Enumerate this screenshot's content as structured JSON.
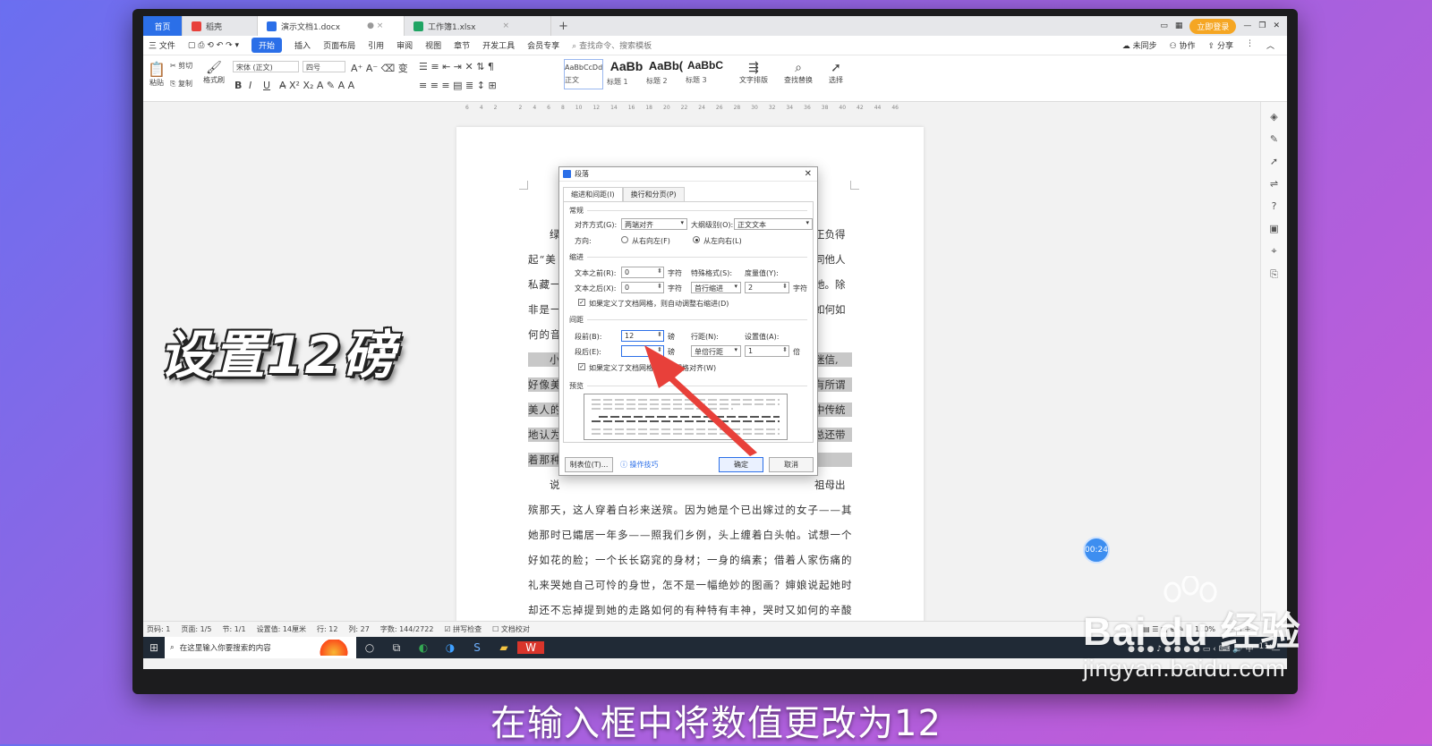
{
  "tabs": [
    {
      "label": "首页"
    },
    {
      "label": "稻壳"
    },
    {
      "label": "演示文档1.docx"
    },
    {
      "label": "工作簿1.xlsx"
    }
  ],
  "topright": {
    "login": "立即登录"
  },
  "menu": {
    "file": "三 文件",
    "items": [
      "开始",
      "插入",
      "页面布局",
      "引用",
      "审阅",
      "视图",
      "章节",
      "开发工具",
      "会员专享"
    ],
    "search": "查找命令、搜索模板",
    "sync": "未同步",
    "collab": "协作",
    "share": "分享"
  },
  "ribbon": {
    "paste": "粘贴",
    "cut": "剪切",
    "copy": "复制",
    "format_painter": "格式刷",
    "font_name": "宋体 (正文)",
    "font_size": "四号",
    "styles": [
      {
        "sample": "AaBbCcDd",
        "label": "正文"
      },
      {
        "sample": "AaBb",
        "label": "标题 1"
      },
      {
        "sample": "AaBb(",
        "label": "标题 2"
      },
      {
        "sample": "AaBbC",
        "label": "标题 3"
      }
    ],
    "text_layout": "文字排版",
    "find_replace": "查找替换",
    "select": "选择"
  },
  "ruler": [
    "6",
    "4",
    "2",
    "",
    "2",
    "4",
    "6",
    "8",
    "10",
    "12",
    "14",
    "16",
    "18",
    "20",
    "22",
    "24",
    "26",
    "28",
    "30",
    "32",
    "34",
    "36",
    "38",
    "40",
    "42",
    "44",
    "46"
  ],
  "document": {
    "lines": [
      {
        "text": "绿",
        "hl": false
      },
      {
        "text": "起“美",
        "hl": false
      },
      {
        "text": "私藏一",
        "hl": false
      },
      {
        "text": "非是一",
        "hl": false
      },
      {
        "text": "何的音",
        "hl": false
      },
      {
        "text": "小",
        "hl": true
      },
      {
        "text": "好像美",
        "hl": true
      },
      {
        "text": "美人的",
        "hl": true
      },
      {
        "text": "地认为",
        "hl": true
      },
      {
        "text": "着那种",
        "hl": true
      },
      {
        "text": "说",
        "hl": false
      },
      {
        "text": "殡那天，这人穿着白衫来送殡。因为她是个已出嫁过的女子——其实",
        "hl": false
      },
      {
        "text": "她那时已孀居一年多——照我们乡例，头上缠着白头帕。试想一个静",
        "hl": false
      },
      {
        "text": "好如花的脸；一个长长窈窕的身材；一身的缟素；借着人家伤痛的丧",
        "hl": false
      },
      {
        "text": "礼来哭她自己可怜的身世，怎不是一幅绝妙的图画？婶娘说起她时，",
        "hl": false
      },
      {
        "text": "却还不忘掉提到她的走路如何的有种特有丰神，哭时又如何的辛酸凄",
        "hl": false
      }
    ],
    "right_fragments": [
      "正负得",
      "同他人",
      "她。除",
      "如何如",
      "迷信,",
      "有所谓",
      "中传统",
      "总还带",
      "祖母出"
    ]
  },
  "dialog": {
    "title": "段落",
    "tab_indent": "缩进和间距(I)",
    "tab_breaks": "换行和分页(P)",
    "sec_general": "常规",
    "align_label": "对齐方式(G):",
    "align_value": "两端对齐",
    "outline_label": "大纲级别(O):",
    "outline_value": "正文文本",
    "direction_label": "方向:",
    "rtl": "从右向左(F)",
    "ltr": "从左向右(L)",
    "sec_indent": "缩进",
    "before_text_label": "文本之前(R):",
    "before_text_value": "0",
    "after_text_label": "文本之后(X):",
    "after_text_value": "0",
    "unit_char": "字符",
    "special_label": "特殊格式(S):",
    "special_value": "首行缩进",
    "measure_label": "度量值(Y):",
    "measure_value": "2",
    "grid_indent": "如果定义了文档网格，则自动调整右缩进(D)",
    "sec_spacing": "间距",
    "before_label": "段前(B):",
    "before_value": "12",
    "after_label": "段后(E):",
    "after_value": "",
    "unit_pound": "磅",
    "line_label": "行距(N):",
    "line_value": "单倍行距",
    "setting_label": "设置值(A):",
    "setting_value": "1",
    "unit_times": "倍",
    "grid_align": "如果定义了文档网格，则与网格对齐(W)",
    "preview": "预览",
    "tabs_btn": "制表位(T)...",
    "tips": "操作技巧",
    "ok": "确定",
    "cancel": "取消"
  },
  "statusbar": {
    "page_no": "页码: 1",
    "pages": "页面: 1/5",
    "section": "节: 1/1",
    "setting": "设置值: 14厘米",
    "row": "行: 12",
    "col": "列: 27",
    "words": "字数: 144/2722",
    "spell": "拼写检查",
    "proof": "文档校对",
    "zoom": "100%"
  },
  "taskbar": {
    "search": "在这里输入你要搜索的内容",
    "time": "11:__"
  },
  "overlay": {
    "title": "设置12磅",
    "caption": "在输入框中将数值更改为12",
    "timer": "00:24"
  },
  "watermark": {
    "brand": "Bai du 经验",
    "url": "jingyan.baidu.com"
  },
  "colors": {
    "accent": "#2b6fe8",
    "arrow": "#e8403a",
    "bg_start": "#6a6ff0",
    "bg_end": "#c85ad8"
  }
}
